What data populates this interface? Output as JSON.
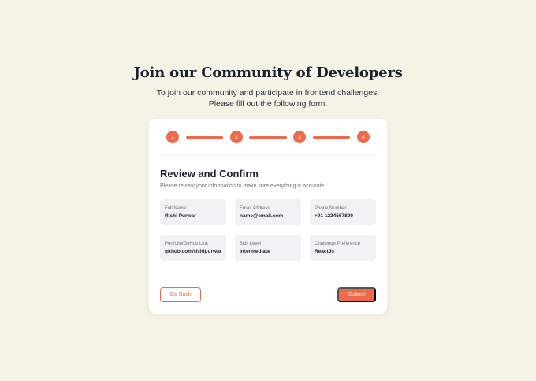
{
  "header": {
    "title": "Join our Community of Developers",
    "subtitle_line1": "To join our community and participate in frontend challenges.",
    "subtitle_line2": "Please fill out the following form."
  },
  "stepper": {
    "steps": [
      "1",
      "2",
      "3",
      "4"
    ],
    "accent": "#f06a4a"
  },
  "review": {
    "title": "Review and Confirm",
    "description": "Please review your information to make sure everything is accurate.",
    "fields": [
      {
        "label": "Full Name",
        "value": "Rishi Purwar"
      },
      {
        "label": "Email Address",
        "value": "name@email.com"
      },
      {
        "label": "Phone Number",
        "value": "+91 1234567890"
      },
      {
        "label": "Portfolio/GitHub Link",
        "value": "github.com/rishipurwar1"
      },
      {
        "label": "Skill Level",
        "value": "Intermediate"
      },
      {
        "label": "Challenge Preference",
        "value": "ReactJs"
      }
    ]
  },
  "actions": {
    "back_label": "Go Back",
    "submit_label": "Submit"
  },
  "colors": {
    "background": "#f4f3e5",
    "accent": "#f06a4a",
    "card": "#ffffff",
    "field": "#f2f2f4"
  }
}
